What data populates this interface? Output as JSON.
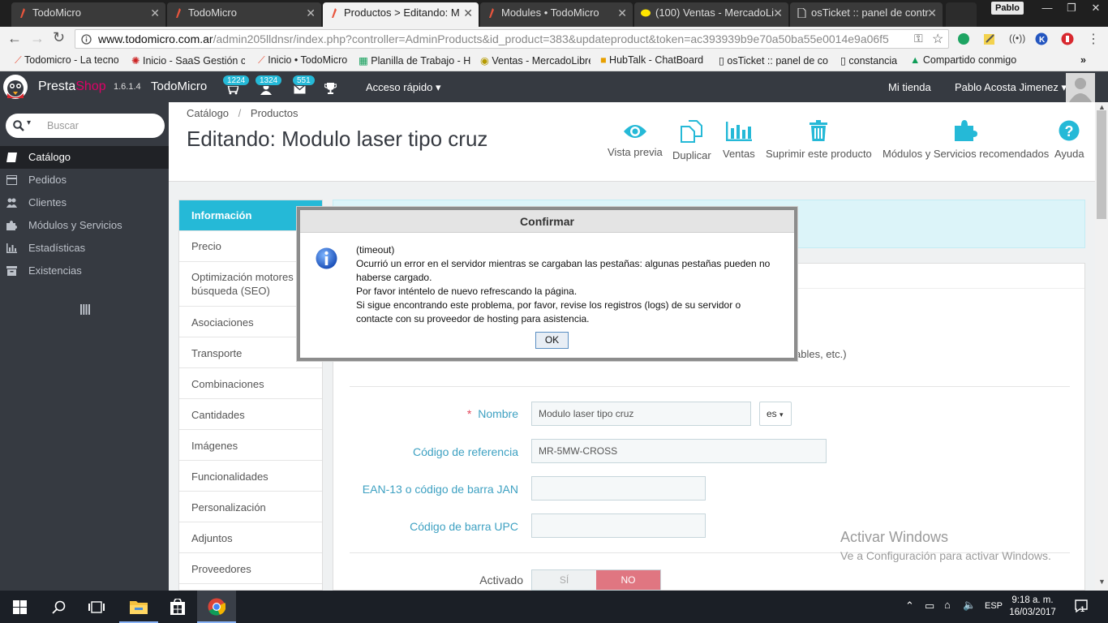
{
  "browser": {
    "tabs": [
      {
        "title": "TodoMicro",
        "active": false
      },
      {
        "title": "TodoMicro",
        "active": false
      },
      {
        "title": "Productos > Editando: M",
        "active": true
      },
      {
        "title": "Modules • TodoMicro",
        "active": false
      },
      {
        "title": "(100) Ventas - MercadoLi",
        "active": false
      },
      {
        "title": "osTicket :: panel de contr",
        "active": false
      }
    ],
    "profile": "Pablo",
    "url_host": "www.todomicro.com.ar",
    "url_path": "/admin205lldnsr/index.php?controller=AdminProducts&id_product=383&updateproduct&token=ac393939b9e70a50ba55e0014e9a06f5",
    "bookmarks": [
      "Todomicro - La tecnol",
      "Inicio - SaaS Gestión c",
      "Inicio • TodoMicro",
      "Planilla de Trabajo - H",
      "Ventas - MercadoLibre",
      "HubTalk - ChatBoard",
      "osTicket :: panel de co",
      "constancia",
      "Compartido conmigo"
    ],
    "bookmarks_more": "»"
  },
  "header": {
    "brand_presta": "Presta",
    "brand_shop": "Shop",
    "version": "1.6.1.4",
    "shop_name": "TodoMicro",
    "badge_orders": "1224",
    "badge_customers": "1324",
    "badge_messages": "551",
    "quick_access": "Acceso rápido",
    "my_shop": "Mi tienda",
    "user": "Pablo Acosta Jimenez"
  },
  "sidebar": {
    "search_placeholder": "Buscar",
    "items": [
      {
        "label": "Catálogo",
        "active": true
      },
      {
        "label": "Pedidos"
      },
      {
        "label": "Clientes"
      },
      {
        "label": "Módulos y Servicios"
      },
      {
        "label": "Estadísticas"
      },
      {
        "label": "Existencias"
      }
    ]
  },
  "page": {
    "breadcrumb_1": "Catálogo",
    "breadcrumb_sep": "/",
    "breadcrumb_2": "Productos",
    "title": "Editando: Modulo laser tipo cruz",
    "toolbar": {
      "preview": "Vista previa",
      "duplicate": "Duplicar",
      "sales": "Ventas",
      "delete": "Suprimir este producto",
      "modules": "Módulos y Servicios recomendados",
      "help": "Ayuda"
    }
  },
  "product_tabs": [
    "Información",
    "Precio",
    "Optimización motores de búsqueda (SEO)",
    "Asociaciones",
    "Transporte",
    "Combinaciones",
    "Cantidades",
    "Imágenes",
    "Funcionalidades",
    "Personalización",
    "Adjuntos",
    "Proveedores"
  ],
  "form": {
    "partial_text": "ables, etc.)",
    "required_mark": "*",
    "name_label": "Nombre",
    "name_value": "Modulo laser tipo cruz",
    "lang": "es",
    "ref_label": "Código de referencia",
    "ref_value": "MR-5MW-CROSS",
    "ean_label": "EAN-13 o código de barra JAN",
    "ean_value": "",
    "upc_label": "Código de barra UPC",
    "upc_value": "",
    "active_label": "Activado",
    "toggle_yes": "SÍ",
    "toggle_no": "NO"
  },
  "modal": {
    "title": "Confirmar",
    "line1": "(timeout)",
    "line2": "Ocurrió un error en el servidor mientras se cargaban las pestañas: algunas pestañas pueden no haberse cargado.",
    "line3": "Por favor inténtelo de nuevo refrescando la página.",
    "line4": "Si sigue encontrando este problema, por favor, revise los registros (logs) de su servidor o contacte con su proveedor de hosting para asistencia.",
    "ok": "OK"
  },
  "watermark": {
    "line1": "Activar Windows",
    "line2": "Ve a Configuración para activar Windows."
  },
  "taskbar": {
    "lang": "ESP",
    "time": "9:18 a. m.",
    "date": "16/03/2017",
    "notifications": "1"
  },
  "colors": {
    "accent": "#25b9d7",
    "sidebar": "#363a41",
    "toggle_no": "#e07681"
  }
}
